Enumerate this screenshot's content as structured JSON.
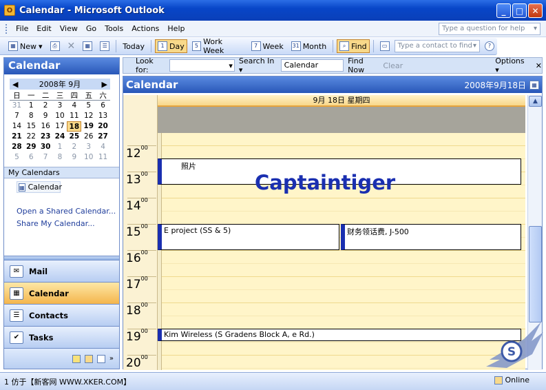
{
  "window": {
    "title": "Calendar - Microsoft Outlook",
    "minimize": "_",
    "maximize": "□",
    "close": "✕"
  },
  "menu": [
    "File",
    "Edit",
    "View",
    "Go",
    "Tools",
    "Actions",
    "Help"
  ],
  "help_placeholder": "Type a question for help",
  "toolbar": {
    "new": "New",
    "today": "Today",
    "day": "Day",
    "work_week": "Work Week",
    "week": "Week",
    "month": "Month",
    "find": "Find",
    "contact_placeholder": "Type a contact to find",
    "day_icon": "1",
    "workweek_icon": "5",
    "week_icon": "7",
    "month_icon": "31"
  },
  "left": {
    "header": "Calendar",
    "minical": {
      "month": "2008年 9月",
      "dow": [
        "日",
        "一",
        "二",
        "三",
        "四",
        "五",
        "六"
      ],
      "weeks": [
        [
          {
            "d": "31",
            "s": "grey"
          },
          {
            "d": "1"
          },
          {
            "d": "2"
          },
          {
            "d": "3"
          },
          {
            "d": "4"
          },
          {
            "d": "5"
          },
          {
            "d": "6"
          }
        ],
        [
          {
            "d": "7"
          },
          {
            "d": "8"
          },
          {
            "d": "9"
          },
          {
            "d": "10"
          },
          {
            "d": "11"
          },
          {
            "d": "12"
          },
          {
            "d": "13"
          }
        ],
        [
          {
            "d": "14"
          },
          {
            "d": "15"
          },
          {
            "d": "16"
          },
          {
            "d": "17"
          },
          {
            "d": "18",
            "s": "today"
          },
          {
            "d": "19",
            "s": "bold"
          },
          {
            "d": "20",
            "s": "bold"
          }
        ],
        [
          {
            "d": "21",
            "s": "bold"
          },
          {
            "d": "22"
          },
          {
            "d": "23",
            "s": "bold"
          },
          {
            "d": "24",
            "s": "bold"
          },
          {
            "d": "25",
            "s": "bold"
          },
          {
            "d": "26"
          },
          {
            "d": "27",
            "s": "bold"
          }
        ],
        [
          {
            "d": "28",
            "s": "bold"
          },
          {
            "d": "29",
            "s": "bold"
          },
          {
            "d": "30",
            "s": "bold"
          },
          {
            "d": "1",
            "s": "grey"
          },
          {
            "d": "2",
            "s": "grey"
          },
          {
            "d": "3",
            "s": "grey"
          },
          {
            "d": "4",
            "s": "grey"
          }
        ],
        [
          {
            "d": "5",
            "s": "grey"
          },
          {
            "d": "6",
            "s": "grey"
          },
          {
            "d": "7",
            "s": "grey"
          },
          {
            "d": "8",
            "s": "grey"
          },
          {
            "d": "9",
            "s": "grey"
          },
          {
            "d": "10",
            "s": "grey"
          },
          {
            "d": "11",
            "s": "grey"
          }
        ]
      ]
    },
    "my_calendars": "My Calendars",
    "calendar_item": "Calendar",
    "open_shared": "Open a Shared Calendar...",
    "share_my": "Share My Calendar...",
    "nav": {
      "mail": "Mail",
      "calendar": "Calendar",
      "contacts": "Contacts",
      "tasks": "Tasks"
    }
  },
  "findbar": {
    "look_for": "Look for:",
    "search_in": "Search In ▾",
    "search_field": "Calendar",
    "find_now": "Find Now",
    "clear": "Clear",
    "options": "Options ▾",
    "close": "✕"
  },
  "calendar": {
    "title": "Calendar",
    "date": "2008年9月18日",
    "day_header": "9月 18日 星期四",
    "hours": [
      {
        "h": "12",
        "m": "00"
      },
      {
        "h": "13",
        "m": "00"
      },
      {
        "h": "14",
        "m": "00"
      },
      {
        "h": "15",
        "m": "00"
      },
      {
        "h": "16",
        "m": "00"
      },
      {
        "h": "17",
        "m": "00"
      },
      {
        "h": "18",
        "m": "00"
      },
      {
        "h": "19",
        "m": "00"
      },
      {
        "h": "20",
        "m": "00"
      }
    ],
    "appointments": {
      "a1": "照片",
      "a2": "E    project (SS &      5)",
      "a3": "财务领话费, J-500",
      "a4": "Kim        Wireless (S         Gradens Block A,                            e Rd.)"
    },
    "watermark": "Captaintiger"
  },
  "status": {
    "left": "1 仿于【新客网 WWW.XKER.COM】",
    "right": "Online"
  },
  "colors": {
    "accent": "#2857b8",
    "selection": "#f8d98a",
    "appt_bar": "#1a2fb0",
    "grid": "#fff5c9"
  }
}
